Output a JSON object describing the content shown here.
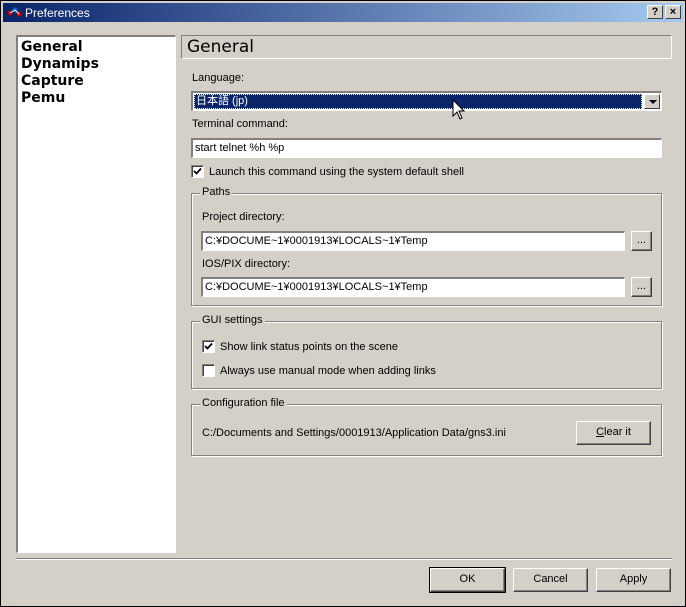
{
  "window": {
    "title": "Preferences",
    "help_label": "?",
    "close_label": "×"
  },
  "nav": {
    "items": [
      {
        "label": "General"
      },
      {
        "label": "Dynamips"
      },
      {
        "label": "Capture"
      },
      {
        "label": "Pemu"
      }
    ]
  },
  "general": {
    "header": "General",
    "language_label": "Language:",
    "language_value": "日本語 (jp)",
    "terminal_label": "Terminal command:",
    "terminal_value": "start telnet %h %p",
    "launch_shell_label": "Launch this command using the system default shell",
    "launch_shell_checked": true
  },
  "paths": {
    "legend": "Paths",
    "project_label": "Project directory:",
    "project_value": "C:¥DOCUME~1¥0001913¥LOCALS~1¥Temp",
    "ios_label": "IOS/PIX directory:",
    "ios_value": "C:¥DOCUME~1¥0001913¥LOCALS~1¥Temp",
    "browse_label": "..."
  },
  "gui": {
    "legend": "GUI settings",
    "show_link_label": "Show link status points on the scene",
    "show_link_checked": true,
    "manual_mode_label": "Always use manual mode when adding links",
    "manual_mode_checked": false
  },
  "config": {
    "legend": "Configuration file",
    "path": "C:/Documents and Settings/0001913/Application Data/gns3.ini",
    "clear_label": "Clear it"
  },
  "footer": {
    "ok_label": "OK",
    "cancel_label": "Cancel",
    "apply_label": "Apply"
  },
  "colors": {
    "titlebar_start": "#0a246a",
    "titlebar_end": "#a6caf0",
    "face": "#d4d0c8",
    "selection": "#0a246a"
  }
}
